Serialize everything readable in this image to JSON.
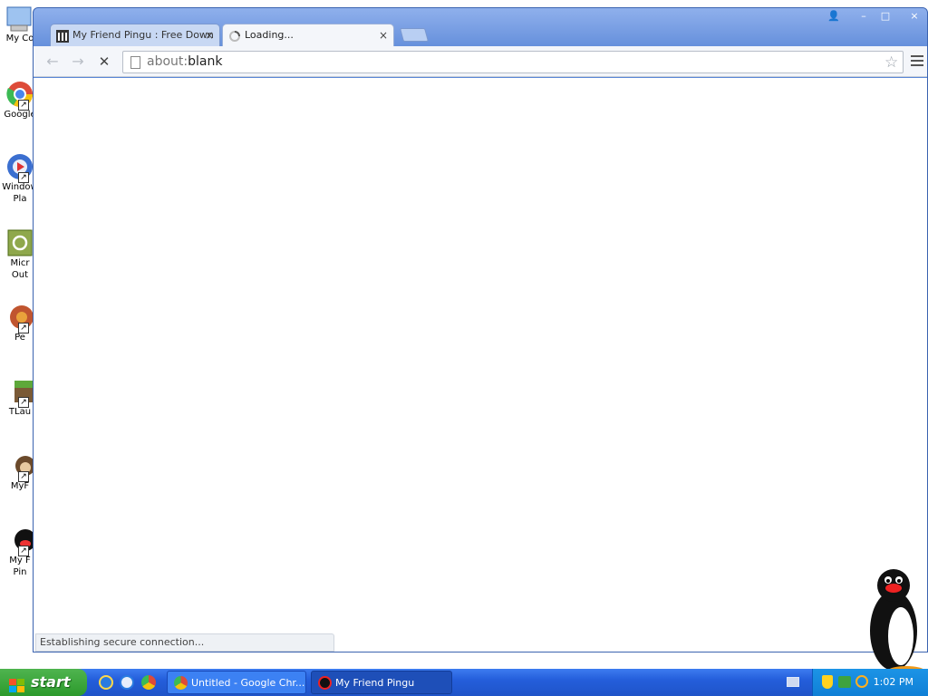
{
  "desktop": {
    "icons": [
      {
        "label": "My Co"
      },
      {
        "label": "Google"
      },
      {
        "label": "Window\nPla"
      },
      {
        "label": "Micr\nOut"
      },
      {
        "label": "Pe"
      },
      {
        "label": "TLau"
      },
      {
        "label": "MyF"
      },
      {
        "label": "My F\nPin"
      }
    ]
  },
  "browser": {
    "tabs": [
      {
        "title": "My Friend Pingu : Free Down",
        "close": "×"
      },
      {
        "title": "Loading...",
        "close": "×"
      }
    ],
    "window_controls": {
      "profile": "👤",
      "minimize": "–",
      "maximize": "□",
      "close": "×"
    },
    "omnibox": {
      "scheme": "about:",
      "path": "blank"
    },
    "status_text": "Establishing secure connection..."
  },
  "taskbar": {
    "start_label": "start",
    "tasks": [
      {
        "label": "Untitled - Google Chr..."
      },
      {
        "label": "My Friend Pingu"
      }
    ],
    "clock": "1:02 PM"
  },
  "colors": {
    "taskbar_blue": "#245edb",
    "start_green": "#3aa63a",
    "window_frame": "#6690dc"
  }
}
